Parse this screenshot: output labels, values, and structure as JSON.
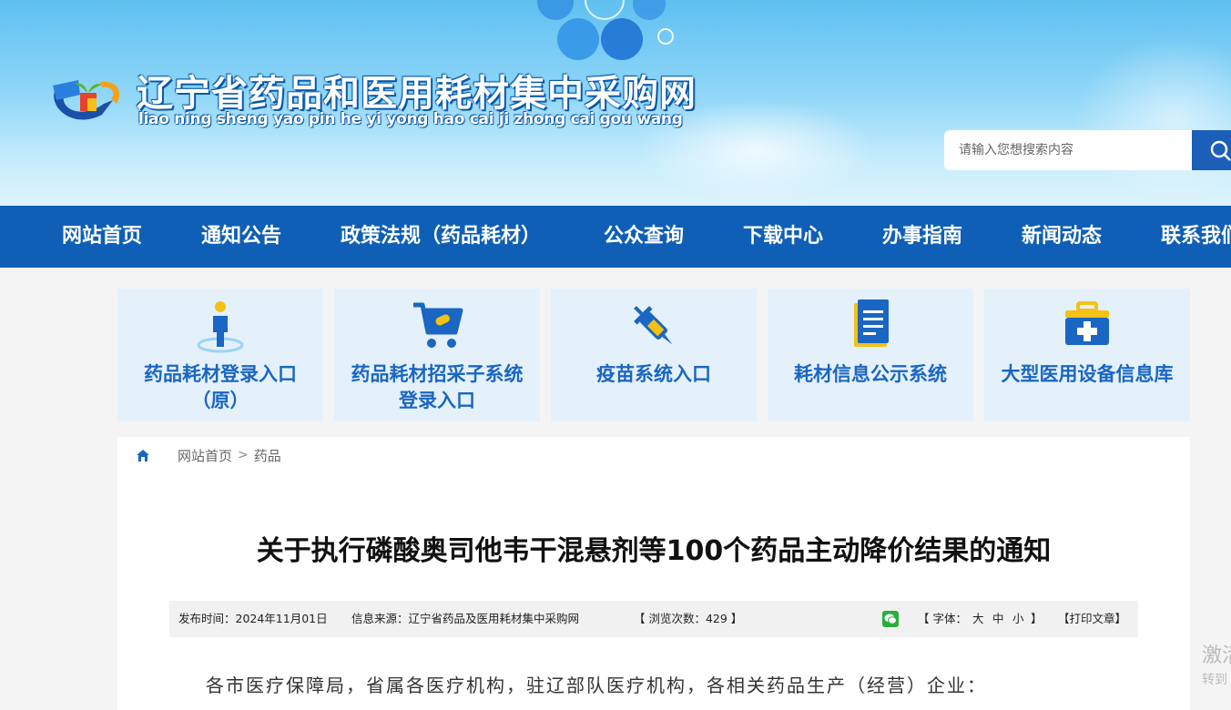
{
  "header": {
    "title": "辽宁省药品和医用耗材集中采购网",
    "pinyin": "liao ning sheng yao pin he yi yong hao cai ji zhong cai gou wang",
    "search_placeholder": "请输入您想搜索内容"
  },
  "nav": {
    "items": [
      "网站首页",
      "通知公告",
      "政策法规（药品耗材）",
      "公众查询",
      "下载中心",
      "办事指南",
      "新闻动态",
      "联系我们"
    ]
  },
  "quick_links": [
    {
      "label": "药品耗材登录入口\n（原）",
      "icon": "person-pin-icon"
    },
    {
      "label": "药品耗材招采子系统\n登录入口",
      "icon": "shopping-cart-icon"
    },
    {
      "label": "疫苗系统入口",
      "icon": "syringe-icon"
    },
    {
      "label": "耗材信息公示系统",
      "icon": "document-list-icon"
    },
    {
      "label": "大型医用设备信息库",
      "icon": "medical-kit-icon"
    }
  ],
  "breadcrumb": {
    "home": "网站首页",
    "sep": ">",
    "current": "药品"
  },
  "article": {
    "title": "关于执行磷酸奥司他韦干混悬剂等100个药品主动降价结果的通知",
    "published": "发布时间：2024年11月01日",
    "source": "信息来源：辽宁省药品及医用耗材集中采购网",
    "views": "【 浏览次数：429 】",
    "font_prefix": "【 字体：",
    "font_large": "大",
    "font_medium": "中",
    "font_small": "小",
    "font_suffix": "】",
    "print": "【打印文章】",
    "first_paragraph": "各市医疗保障局，省属各医疗机构，驻辽部队医疗机构，各相关药品生产（经营）企业："
  },
  "side_partial": {
    "line1": "激活",
    "line2": "转到"
  },
  "colors": {
    "nav_bg": "#0f5fb6",
    "card_bg": "#e4f1fb",
    "card_text": "#1a66c2",
    "accent_yellow": "#f5c114"
  }
}
